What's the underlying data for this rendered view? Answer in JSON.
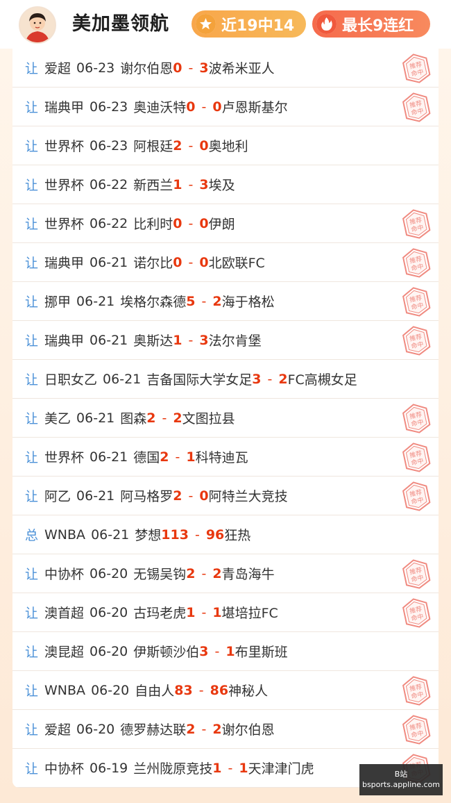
{
  "header": {
    "expert_name": "美加墨领航",
    "badge_recent": "近19中14",
    "badge_streak": "最长9连红"
  },
  "stamp_text": [
    "推荐",
    "命中"
  ],
  "matches": [
    {
      "tag": "让",
      "league": "爱超",
      "date": "06-23",
      "home": "谢尔伯恩",
      "home_score": "0",
      "away_score": "3",
      "away": "波希米亚人",
      "hit": true
    },
    {
      "tag": "让",
      "league": "瑞典甲",
      "date": "06-23",
      "home": "奥迪沃特",
      "home_score": "0",
      "away_score": "0",
      "away": "卢恩斯基尔",
      "hit": true
    },
    {
      "tag": "让",
      "league": "世界杯",
      "date": "06-23",
      "home": "阿根廷",
      "home_score": "2",
      "away_score": "0",
      "away": "奥地利",
      "hit": false
    },
    {
      "tag": "让",
      "league": "世界杯",
      "date": "06-22",
      "home": "新西兰",
      "home_score": "1",
      "away_score": "3",
      "away": "埃及",
      "hit": false
    },
    {
      "tag": "让",
      "league": "世界杯",
      "date": "06-22",
      "home": "比利时",
      "home_score": "0",
      "away_score": "0",
      "away": "伊朗",
      "hit": true
    },
    {
      "tag": "让",
      "league": "瑞典甲",
      "date": "06-21",
      "home": "诺尔比",
      "home_score": "0",
      "away_score": "0",
      "away": "北欧联FC",
      "hit": true
    },
    {
      "tag": "让",
      "league": "挪甲",
      "date": "06-21",
      "home": "埃格尔森德",
      "home_score": "5",
      "away_score": "2",
      "away": "海于格松",
      "hit": true
    },
    {
      "tag": "让",
      "league": "瑞典甲",
      "date": "06-21",
      "home": "奥斯达",
      "home_score": "1",
      "away_score": "3",
      "away": "法尔肯堡",
      "hit": true
    },
    {
      "tag": "让",
      "league": "日职女乙",
      "date": "06-21",
      "home": "吉备国际大学女足",
      "home_score": "3",
      "away_score": "2",
      "away": "FC高槻女足",
      "hit": false
    },
    {
      "tag": "让",
      "league": "美乙",
      "date": "06-21",
      "home": "图森",
      "home_score": "2",
      "away_score": "2",
      "away": "文图拉县",
      "hit": true
    },
    {
      "tag": "让",
      "league": "世界杯",
      "date": "06-21",
      "home": "德国",
      "home_score": "2",
      "away_score": "1",
      "away": "科特迪瓦",
      "hit": true
    },
    {
      "tag": "让",
      "league": "阿乙",
      "date": "06-21",
      "home": "阿马格罗",
      "home_score": "2",
      "away_score": "0",
      "away": "阿特兰大竞技",
      "hit": true
    },
    {
      "tag": "总",
      "league": "WNBA",
      "date": "06-21",
      "home": "梦想",
      "home_score": "113",
      "away_score": "96",
      "away": "狂热",
      "hit": false
    },
    {
      "tag": "让",
      "league": "中协杯",
      "date": "06-20",
      "home": "无锡吴钩",
      "home_score": "2",
      "away_score": "2",
      "away": "青岛海牛",
      "hit": true
    },
    {
      "tag": "让",
      "league": "澳首超",
      "date": "06-20",
      "home": "古玛老虎",
      "home_score": "1",
      "away_score": "1",
      "away": "堪培拉FC",
      "hit": true
    },
    {
      "tag": "让",
      "league": "澳昆超",
      "date": "06-20",
      "home": "伊斯顿沙伯",
      "home_score": "3",
      "away_score": "1",
      "away": "布里斯班",
      "hit": false
    },
    {
      "tag": "让",
      "league": "WNBA",
      "date": "06-20",
      "home": "自由人",
      "home_score": "83",
      "away_score": "86",
      "away": "神秘人",
      "hit": true
    },
    {
      "tag": "让",
      "league": "爱超",
      "date": "06-20",
      "home": "德罗赫达联",
      "home_score": "2",
      "away_score": "2",
      "away": "谢尔伯恩",
      "hit": true
    },
    {
      "tag": "让",
      "league": "中协杯",
      "date": "06-19",
      "home": "兰州陇原竞技",
      "home_score": "1",
      "away_score": "1",
      "away": "天津津门虎",
      "hit": true
    }
  ],
  "watermark": {
    "line1": "B站",
    "line2": "bsports.appline.com"
  },
  "colors": {
    "score": "#e8380f",
    "tag": "#4d92d8",
    "badge_recent": "#f8a64a",
    "badge_streak": "#f56a4c",
    "stamp": "#f08a80"
  },
  "icons": {
    "badge_recent": "star-icon",
    "badge_streak": "flame-icon",
    "stamp": "hit-stamp-icon"
  }
}
